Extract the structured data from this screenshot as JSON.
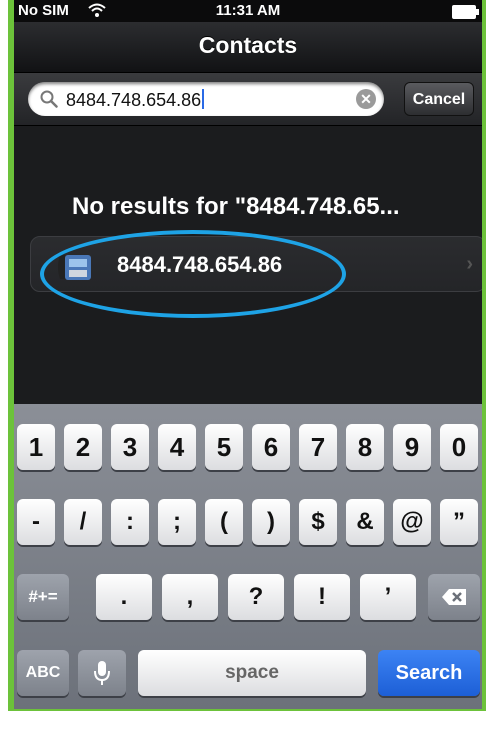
{
  "status_bar": {
    "carrier": "No SIM",
    "time": "11:31 AM",
    "wifi_icon": "wifi-icon",
    "battery_icon": "battery-icon"
  },
  "nav": {
    "title": "Contacts"
  },
  "search": {
    "value": "8484.748.654.86",
    "cancel_label": "Cancel",
    "clear_icon": "clear-x-icon",
    "search_icon": "magnifier-icon"
  },
  "results": {
    "no_results_text": "No results for \"8484.748.65...",
    "row_label": "8484.748.654.86",
    "row_icon": "phone-handset-icon",
    "chevron": "›"
  },
  "annotation": {
    "color": "#1ea3e6"
  },
  "keyboard": {
    "row1": [
      "1",
      "2",
      "3",
      "4",
      "5",
      "6",
      "7",
      "8",
      "9",
      "0"
    ],
    "row2": [
      "-",
      "/",
      ":",
      ";",
      "(",
      ")",
      "$",
      "&",
      "@",
      "”"
    ],
    "row3_mode": "#+=",
    "row3": [
      ".",
      ",",
      "?",
      "!",
      "’"
    ],
    "backspace_icon": "backspace-icon",
    "abc_label": "ABC",
    "mic_icon": "microphone-icon",
    "space_label": "space",
    "search_label": "Search"
  },
  "colors": {
    "frame": "#6cc23a",
    "search_key": "#1d5fd6"
  }
}
